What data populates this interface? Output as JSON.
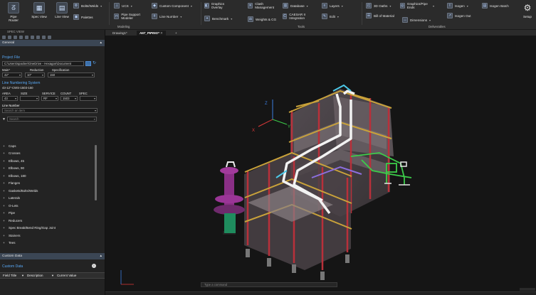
{
  "ribbon": {
    "pipe_router": "Pipe Router",
    "spec_view": "Spec View",
    "line_view": "Line View",
    "bolts_welds": "Bolts/Welds",
    "palettes": "Palettes",
    "ucs": "UCS",
    "pipe_support_modeler": "Pipe Support Modeler",
    "custom_component": "Custom Component",
    "line_number": "Line Number",
    "graphics_overlay": "Graphics Overlay",
    "benchmark": "Benchmark",
    "clash_management": "Clash Management",
    "weights_cg": "Weights & CG",
    "database": "Database",
    "caesar_integration": "CAESAR II Integration",
    "layers": "Layers",
    "edit": "Edit",
    "three_d_oaths": "3D Oaths",
    "bill_of_material": "Bill of Material",
    "graphics_pipe_ends": "Graphics/Pipe Ends",
    "dimensions": "Dimensions",
    "isogen": "Isogen",
    "isogen_out": "Isogen Out",
    "isogen_batch": "Isogen Batch",
    "setup": "Setup",
    "group_modeling": "Modeling",
    "group_tools": "Tools",
    "group_deliverables": "Deliverables"
  },
  "doc_tabs": [
    {
      "label": "Drawing1*"
    },
    {
      "label": "A67_PIPING*"
    }
  ],
  "doc_tab_add": "+",
  "panel": {
    "title": "SPEC VIEW",
    "general": "General",
    "project_file_label": "Project File",
    "project_file_value": "C:\\Users\\spacker\\OneDrive - Hexagon\\Document",
    "main_label": "Main*",
    "reduction_label": "Reduction",
    "specification_label": "Specification",
    "main_value": "42\"",
    "reduction_value": "10\"",
    "specification_value": "150",
    "line_numbering_label": "Line Numbering System",
    "line_numbering_value": "43-12\"-CWS-1503-150",
    "area_label": "AREA",
    "size_label": "SIZE",
    "service_label": "SERVICE",
    "count_label": "COUNT",
    "spec_label": "SPEC",
    "area_value": "43",
    "service_value": "RF",
    "count_value": "1503",
    "line_number_label": "Line Number",
    "line_number_placeholder": "Search an item",
    "search_placeholder": "Search",
    "items": [
      {
        "label": "Caps"
      },
      {
        "label": "Crosses"
      },
      {
        "label": "Elbows, 45"
      },
      {
        "label": "Elbows, 90"
      },
      {
        "label": "Elbows, 180"
      },
      {
        "label": "Flanges"
      },
      {
        "label": "Gaskets/Bolts/Welds"
      },
      {
        "label": "Laterals"
      },
      {
        "label": "O-Lets"
      },
      {
        "label": "Pipe"
      },
      {
        "label": "Reducers"
      },
      {
        "label": "Spec Break/Bend Ring/Gap Joint"
      },
      {
        "label": "Stainers"
      },
      {
        "label": "Tees"
      }
    ],
    "custom_data": "Custom Data",
    "custom_data_label": "Custom Data",
    "field_title": "Field Title",
    "description": "Description",
    "current_value": "Current Value"
  },
  "viewport": {
    "axis_x": "X",
    "axis_y": "Y",
    "axis_z": "Z",
    "command_placeholder": "Type a command"
  }
}
